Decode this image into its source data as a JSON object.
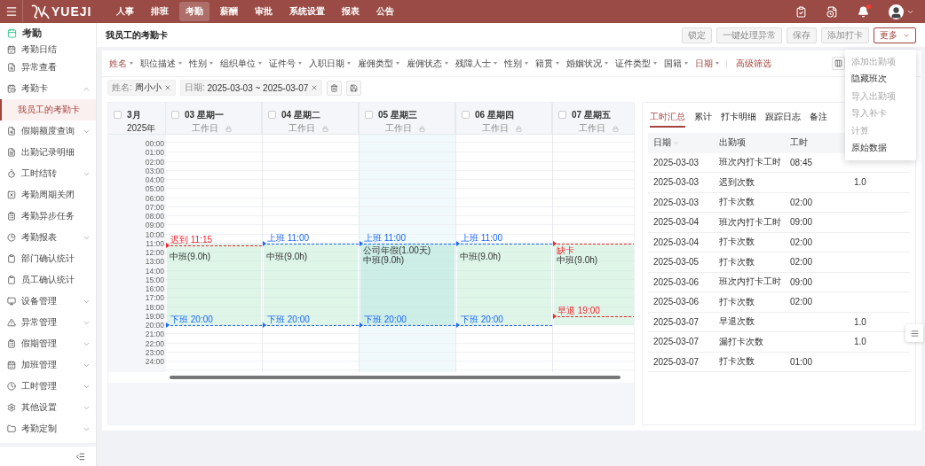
{
  "nav": {
    "logo": "YUEJI",
    "items": [
      {
        "label": "人事",
        "selected": false
      },
      {
        "label": "排班",
        "selected": false
      },
      {
        "label": "考勤",
        "selected": true
      },
      {
        "label": "薪酬",
        "selected": false
      },
      {
        "label": "审批",
        "selected": false
      },
      {
        "label": "系统设置",
        "selected": false
      },
      {
        "label": "报表",
        "selected": false
      },
      {
        "label": "公告",
        "selected": false
      }
    ],
    "notifications_unread": true
  },
  "sidebar": {
    "title": "考勤",
    "items": [
      {
        "label": "考勤日结",
        "kind": "page"
      },
      {
        "label": "异常查看",
        "kind": "page"
      },
      {
        "label": "考勤卡",
        "kind": "group",
        "expanded": true,
        "children": [
          {
            "label": "我员工的考勤卡",
            "selected": true
          }
        ]
      },
      {
        "label": "假期额度查询",
        "kind": "group",
        "expanded": false
      },
      {
        "label": "出勤记录明细",
        "kind": "page"
      },
      {
        "label": "工时结转",
        "kind": "group",
        "expanded": false
      },
      {
        "label": "考勤周期关闭",
        "kind": "page"
      },
      {
        "label": "考勤异步任务",
        "kind": "page"
      },
      {
        "label": "考勤报表",
        "kind": "group",
        "expanded": false
      },
      {
        "label": "部门确认统计",
        "kind": "page"
      },
      {
        "label": "员工确认统计",
        "kind": "page"
      },
      {
        "label": "设备管理",
        "kind": "group",
        "expanded": false
      },
      {
        "label": "异常管理",
        "kind": "group",
        "expanded": false
      },
      {
        "label": "假期管理",
        "kind": "group",
        "expanded": false
      },
      {
        "label": "加班管理",
        "kind": "group",
        "expanded": false
      },
      {
        "label": "工时管理",
        "kind": "group",
        "expanded": false
      },
      {
        "label": "其他设置",
        "kind": "group",
        "expanded": false
      },
      {
        "label": "考勤定制",
        "kind": "group",
        "expanded": false
      }
    ]
  },
  "page": {
    "title": "我员工的考勤卡",
    "buttons": [
      {
        "label": "锁定",
        "disabled": true
      },
      {
        "label": "一键处理异常",
        "disabled": true
      },
      {
        "label": "保存",
        "disabled": true
      },
      {
        "label": "添加打卡",
        "disabled": true
      },
      {
        "label": "更多",
        "disabled": false,
        "kind": "menu"
      }
    ]
  },
  "filters": [
    {
      "label": "姓名",
      "active": true
    },
    {
      "label": "职位描述",
      "active": false
    },
    {
      "label": "性别",
      "active": false
    },
    {
      "label": "组织单位",
      "active": false
    },
    {
      "label": "证件号",
      "active": false
    },
    {
      "label": "入职日期",
      "active": false
    },
    {
      "label": "雇佣类型",
      "active": false
    },
    {
      "label": "雇佣状态",
      "active": false
    },
    {
      "label": "残障人士",
      "active": false
    },
    {
      "label": "性别",
      "active": false
    },
    {
      "label": "籍贯",
      "active": false
    },
    {
      "label": "婚姻状况",
      "active": false
    },
    {
      "label": "证件类型",
      "active": false
    },
    {
      "label": "国籍",
      "active": false
    },
    {
      "label": "日期",
      "active": true
    }
  ],
  "advanced_filter": "高级筛选",
  "chips": [
    {
      "field": "姓名:",
      "value": "周小小"
    },
    {
      "field": "日期:",
      "value": "2025-03-03 ~ 2025-03-07"
    }
  ],
  "calendar": {
    "month": "3月",
    "year": "2025年",
    "checked": false,
    "times": [
      {
        "label": "00:00"
      },
      {
        "label": "01:00"
      },
      {
        "label": "02:00"
      },
      {
        "label": "03:00"
      },
      {
        "label": "04:00"
      },
      {
        "label": "05:00"
      },
      {
        "label": "06:00"
      },
      {
        "label": "07:00"
      },
      {
        "label": "08:00"
      },
      {
        "label": "09:00"
      },
      {
        "label": "10:00"
      },
      {
        "label": "11:00",
        "kind": "shift_start"
      },
      {
        "label": "12:00"
      },
      {
        "label": "13:00"
      },
      {
        "label": "14:00"
      },
      {
        "label": "15:00"
      },
      {
        "label": "16:00"
      },
      {
        "label": "17:00"
      },
      {
        "label": "18:00"
      },
      {
        "label": "19:00"
      },
      {
        "label": "20:00",
        "kind": "shift_end"
      },
      {
        "label": "21:00"
      },
      {
        "label": "22:00"
      },
      {
        "label": "23:00"
      },
      {
        "label": "24:00"
      }
    ],
    "days": [
      {
        "day": "03",
        "weekday": "星期一",
        "type": "工作日",
        "checked": false,
        "highlighted": false,
        "markers": [
          {
            "kind": "late",
            "verb": "迟到",
            "time": "11:15"
          },
          {
            "kind": "off",
            "verb": "下班",
            "time": "20:00"
          }
        ],
        "notes": [
          {
            "kind": "shift",
            "text": "中班(9.0h)"
          }
        ]
      },
      {
        "day": "04",
        "weekday": "星期二",
        "type": "工作日",
        "checked": false,
        "highlighted": false,
        "markers": [
          {
            "kind": "on",
            "verb": "上班",
            "time": "11:00"
          },
          {
            "kind": "off",
            "verb": "下班",
            "time": "20:00"
          }
        ],
        "notes": [
          {
            "kind": "shift",
            "text": "中班(9.0h)"
          }
        ]
      },
      {
        "day": "05",
        "weekday": "星期三",
        "type": "工作日",
        "checked": false,
        "highlighted": true,
        "markers": [
          {
            "kind": "on",
            "verb": "上班",
            "time": "11:00"
          },
          {
            "kind": "off",
            "verb": "下班",
            "time": "20:00"
          }
        ],
        "notes": [
          {
            "kind": "leave",
            "text": "公司年假(1.00天)"
          },
          {
            "kind": "shift",
            "text": "中班(9.0h)"
          }
        ]
      },
      {
        "day": "06",
        "weekday": "星期四",
        "type": "工作日",
        "checked": false,
        "highlighted": false,
        "markers": [
          {
            "kind": "on",
            "verb": "上班",
            "time": "11:00"
          },
          {
            "kind": "off",
            "verb": "下班",
            "time": "20:00"
          }
        ],
        "notes": [
          {
            "kind": "shift",
            "text": "中班(9.0h)"
          }
        ]
      },
      {
        "day": "07",
        "weekday": "星期五",
        "type": "工作日",
        "checked": false,
        "highlighted": false,
        "markers": [
          {
            "kind": "missing"
          },
          {
            "kind": "early",
            "verb": "早退",
            "time": "19:00"
          }
        ],
        "notes": [
          {
            "kind": "alert",
            "text": "缺卡"
          },
          {
            "kind": "shift",
            "text": "中班(9.0h)"
          }
        ]
      }
    ]
  },
  "panel": {
    "tabs": [
      {
        "label": "工时汇总",
        "selected": true
      },
      {
        "label": "累计",
        "selected": false
      },
      {
        "label": "打卡明细",
        "selected": false
      },
      {
        "label": "跟踪日志",
        "selected": false
      },
      {
        "label": "备注",
        "selected": false
      }
    ],
    "columns": [
      {
        "label": "日期",
        "sortable": true
      },
      {
        "label": "出勤项",
        "sortable": false
      },
      {
        "label": "工时",
        "sortable": false
      }
    ],
    "rows": [
      {
        "date": "2025-03-03",
        "item": "班次内打卡工时",
        "hours": "08:45"
      },
      {
        "date": "2025-03-03",
        "item": "迟到次数",
        "column_4": "1.0"
      },
      {
        "date": "2025-03-03",
        "item": "打卡次数",
        "hours": "02:00"
      },
      {
        "date": "2025-03-04",
        "item": "班次内打卡工时",
        "hours": "09:00"
      },
      {
        "date": "2025-03-04",
        "item": "打卡次数",
        "hours": "02:00"
      },
      {
        "date": "2025-03-05",
        "item": "打卡次数",
        "hours": "02:00"
      },
      {
        "date": "2025-03-06",
        "item": "班次内打卡工时",
        "hours": "09:00"
      },
      {
        "date": "2025-03-06",
        "item": "打卡次数",
        "hours": "02:00"
      },
      {
        "date": "2025-03-07",
        "item": "早退次数",
        "column_4": "1.0"
      },
      {
        "date": "2025-03-07",
        "item": "漏打卡次数",
        "column_4": "1.0"
      },
      {
        "date": "2025-03-07",
        "item": "打卡次数",
        "hours": "01:00"
      }
    ]
  },
  "menu": {
    "items": [
      {
        "label": "添加出勤项",
        "disabled": true
      },
      {
        "label": "隐藏班次",
        "disabled": false
      },
      {
        "label": "导入出勤项",
        "disabled": true
      },
      {
        "label": "导入补卡",
        "disabled": true
      },
      {
        "label": "计算",
        "disabled": true
      },
      {
        "label": "原始数据",
        "disabled": false
      }
    ]
  }
}
